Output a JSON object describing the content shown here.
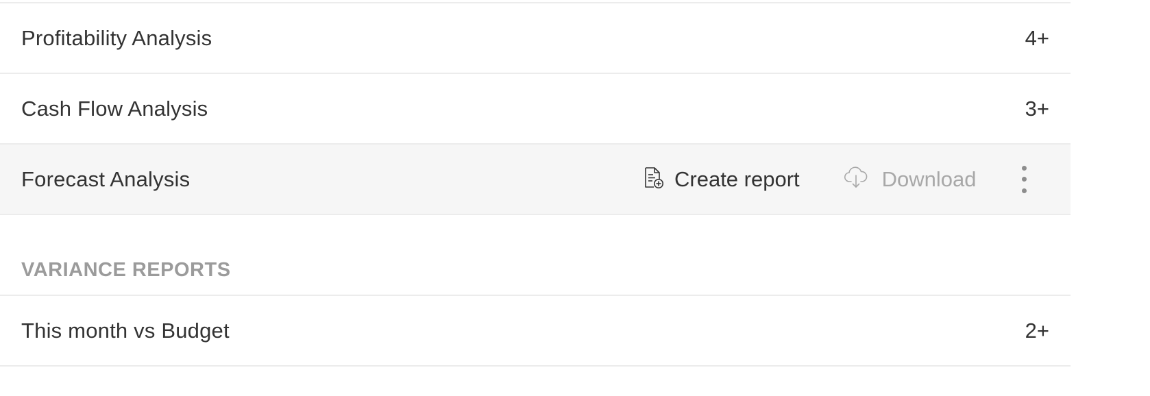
{
  "reports": [
    {
      "label": "Profitability Analysis",
      "count": "4+"
    },
    {
      "label": "Cash Flow Analysis",
      "count": "3+"
    },
    {
      "label": "Forecast Analysis",
      "count": ""
    }
  ],
  "row_actions": {
    "create_label": "Create report",
    "create_icon": "document-plus-icon",
    "download_label": "Download",
    "download_icon": "cloud-download-icon",
    "more_icon": "kebab-menu-icon"
  },
  "variance_section": {
    "title": "VARIANCE REPORTS",
    "items": [
      {
        "label": "This month vs Budget",
        "count": "2+"
      }
    ]
  },
  "colors": {
    "text": "#333333",
    "muted": "#9b9b9b",
    "disabled": "#a8a8a8",
    "hover_row": "#f6f6f6",
    "divider": "#ececec"
  }
}
